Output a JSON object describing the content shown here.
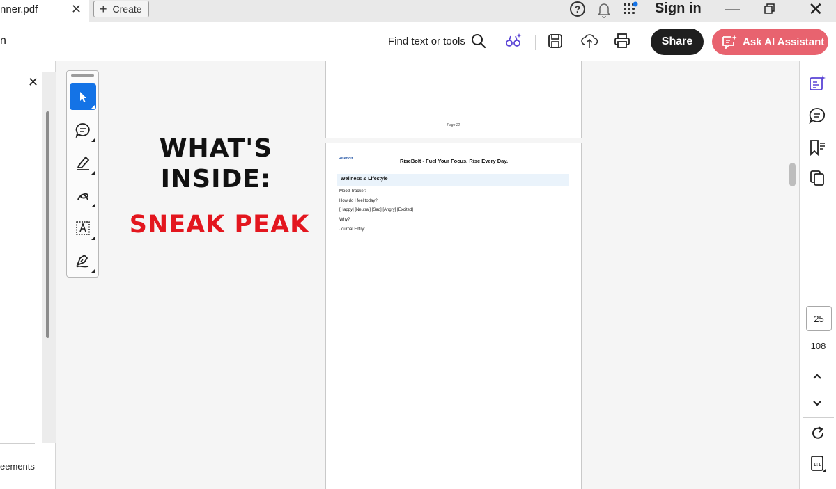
{
  "tab": {
    "title": "nner.pdf",
    "close_glyph": "✕"
  },
  "tabbar": {
    "create_label": "Create",
    "signin_label": "Sign in"
  },
  "toolbar": {
    "left_text": "n",
    "find_label": "Find text or tools",
    "share_label": "Share",
    "ai_label": "Ask AI Assistant"
  },
  "left_panel": {
    "close_glyph": "✕",
    "bottom_label": "eements"
  },
  "promo": {
    "line1": "WHAT'S",
    "line2": "INSIDE:",
    "subtitle": "SNEAK PEAK"
  },
  "document": {
    "prev_page_label": "Page 22",
    "logo_text": "RiseBolt",
    "header": "RiseBolt - Fuel Your Focus. Rise Every Day.",
    "section": "Wellness & Lifestyle",
    "lines": [
      "Mood Tracker:",
      "How do I feel today?",
      "[Happy] [Neutral] [Sad] [Angry] [Excited]",
      "Why?",
      "Journal Entry:"
    ]
  },
  "pagination": {
    "current": "25",
    "total": "108"
  },
  "colors": {
    "accent": "#1473e6",
    "share_bg": "#1f1f1f",
    "ai_bg": "#e8636f",
    "promo_red": "#e3161e",
    "icon_purple": "#5b45d6"
  },
  "icons": [
    "close-icon",
    "plus-icon",
    "help-icon",
    "bell-icon",
    "apps-grid-icon",
    "minimize-icon",
    "restore-icon",
    "search-icon",
    "magic-edit-icon",
    "save-icon",
    "cloud-upload-icon",
    "print-icon",
    "ai-assistant-icon",
    "select-cursor-icon",
    "comment-icon",
    "highlight-pen-icon",
    "draw-freehand-icon",
    "text-box-icon",
    "signature-icon",
    "generative-summary-icon",
    "comments-panel-icon",
    "bookmarks-icon",
    "pages-icon",
    "chevron-up-icon",
    "chevron-down-icon",
    "rotate-icon",
    "actual-size-icon"
  ]
}
